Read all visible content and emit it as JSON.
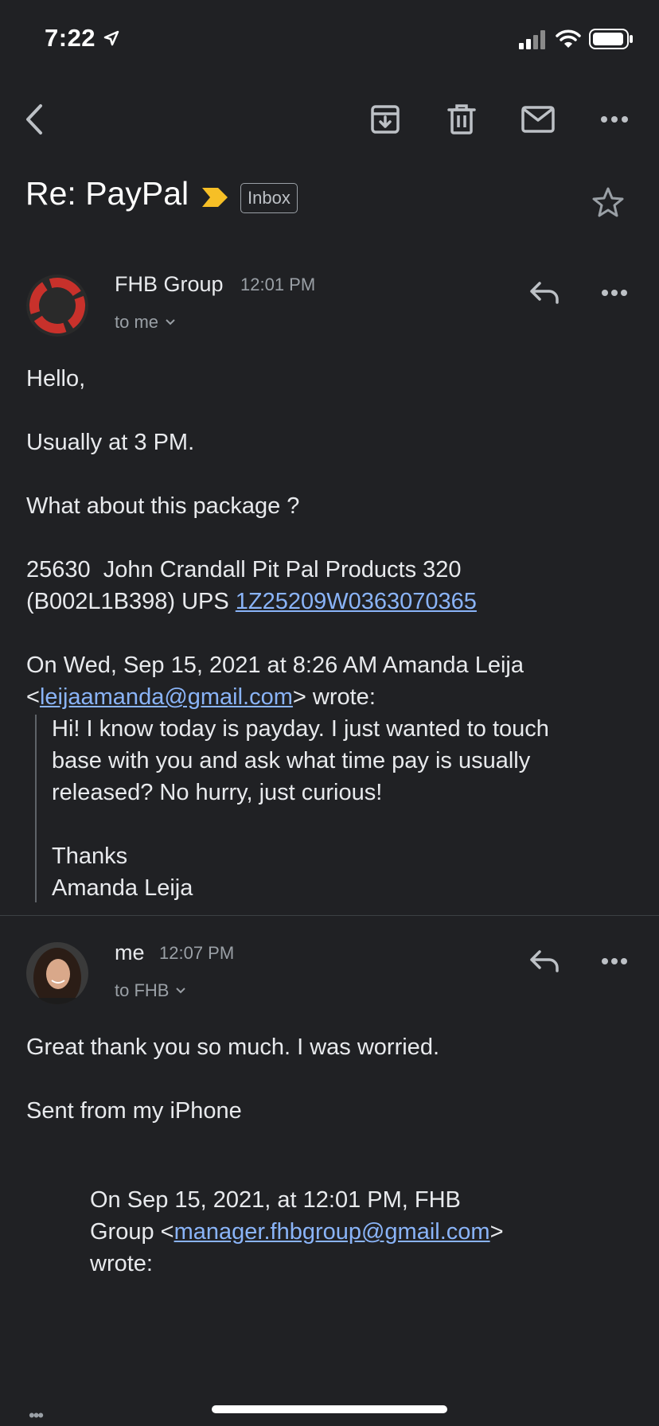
{
  "status_bar": {
    "time": "7:22"
  },
  "subject": {
    "title": "Re: PayPal",
    "label": "Inbox",
    "importance_color": "#f6bf26"
  },
  "messages": [
    {
      "sender": "FHB Group",
      "time": "12:01 PM",
      "to": "to me",
      "lines": {
        "greeting": "Hello,",
        "p1": "Usually at 3 PM.",
        "p2": "What about this package ?",
        "p3a": "25630  John Crandall Pit Pal Products 320",
        "p3b": "(B002L1B398) UPS ",
        "tracking": "1Z25209W0363070365",
        "quote_header_a": "On Wed, Sep 15, 2021 at 8:26 AM Amanda Leija",
        "quote_lt": "<",
        "quote_email": "leijaamanda@gmail.com",
        "quote_wrote": "> wrote:",
        "q1": "Hi! I know today is payday. I just wanted to touch",
        "q2": "base with you and ask what time pay is usually",
        "q3": "released? No hurry, just curious!",
        "q4": "Thanks",
        "q5": "Amanda Leija"
      }
    },
    {
      "sender": "me",
      "time": "12:07 PM",
      "to": "to FHB",
      "lines": {
        "p1": "Great thank you so much. I was worried.",
        "p2": "Sent from my iPhone",
        "q1": "On Sep 15, 2021, at 12:01 PM, FHB",
        "q2a": "Group <",
        "q2_email": "manager.fhbgroup@gmail.com",
        "q2b": ">",
        "q3": "wrote:"
      }
    }
  ],
  "overflow_dots": "•••"
}
